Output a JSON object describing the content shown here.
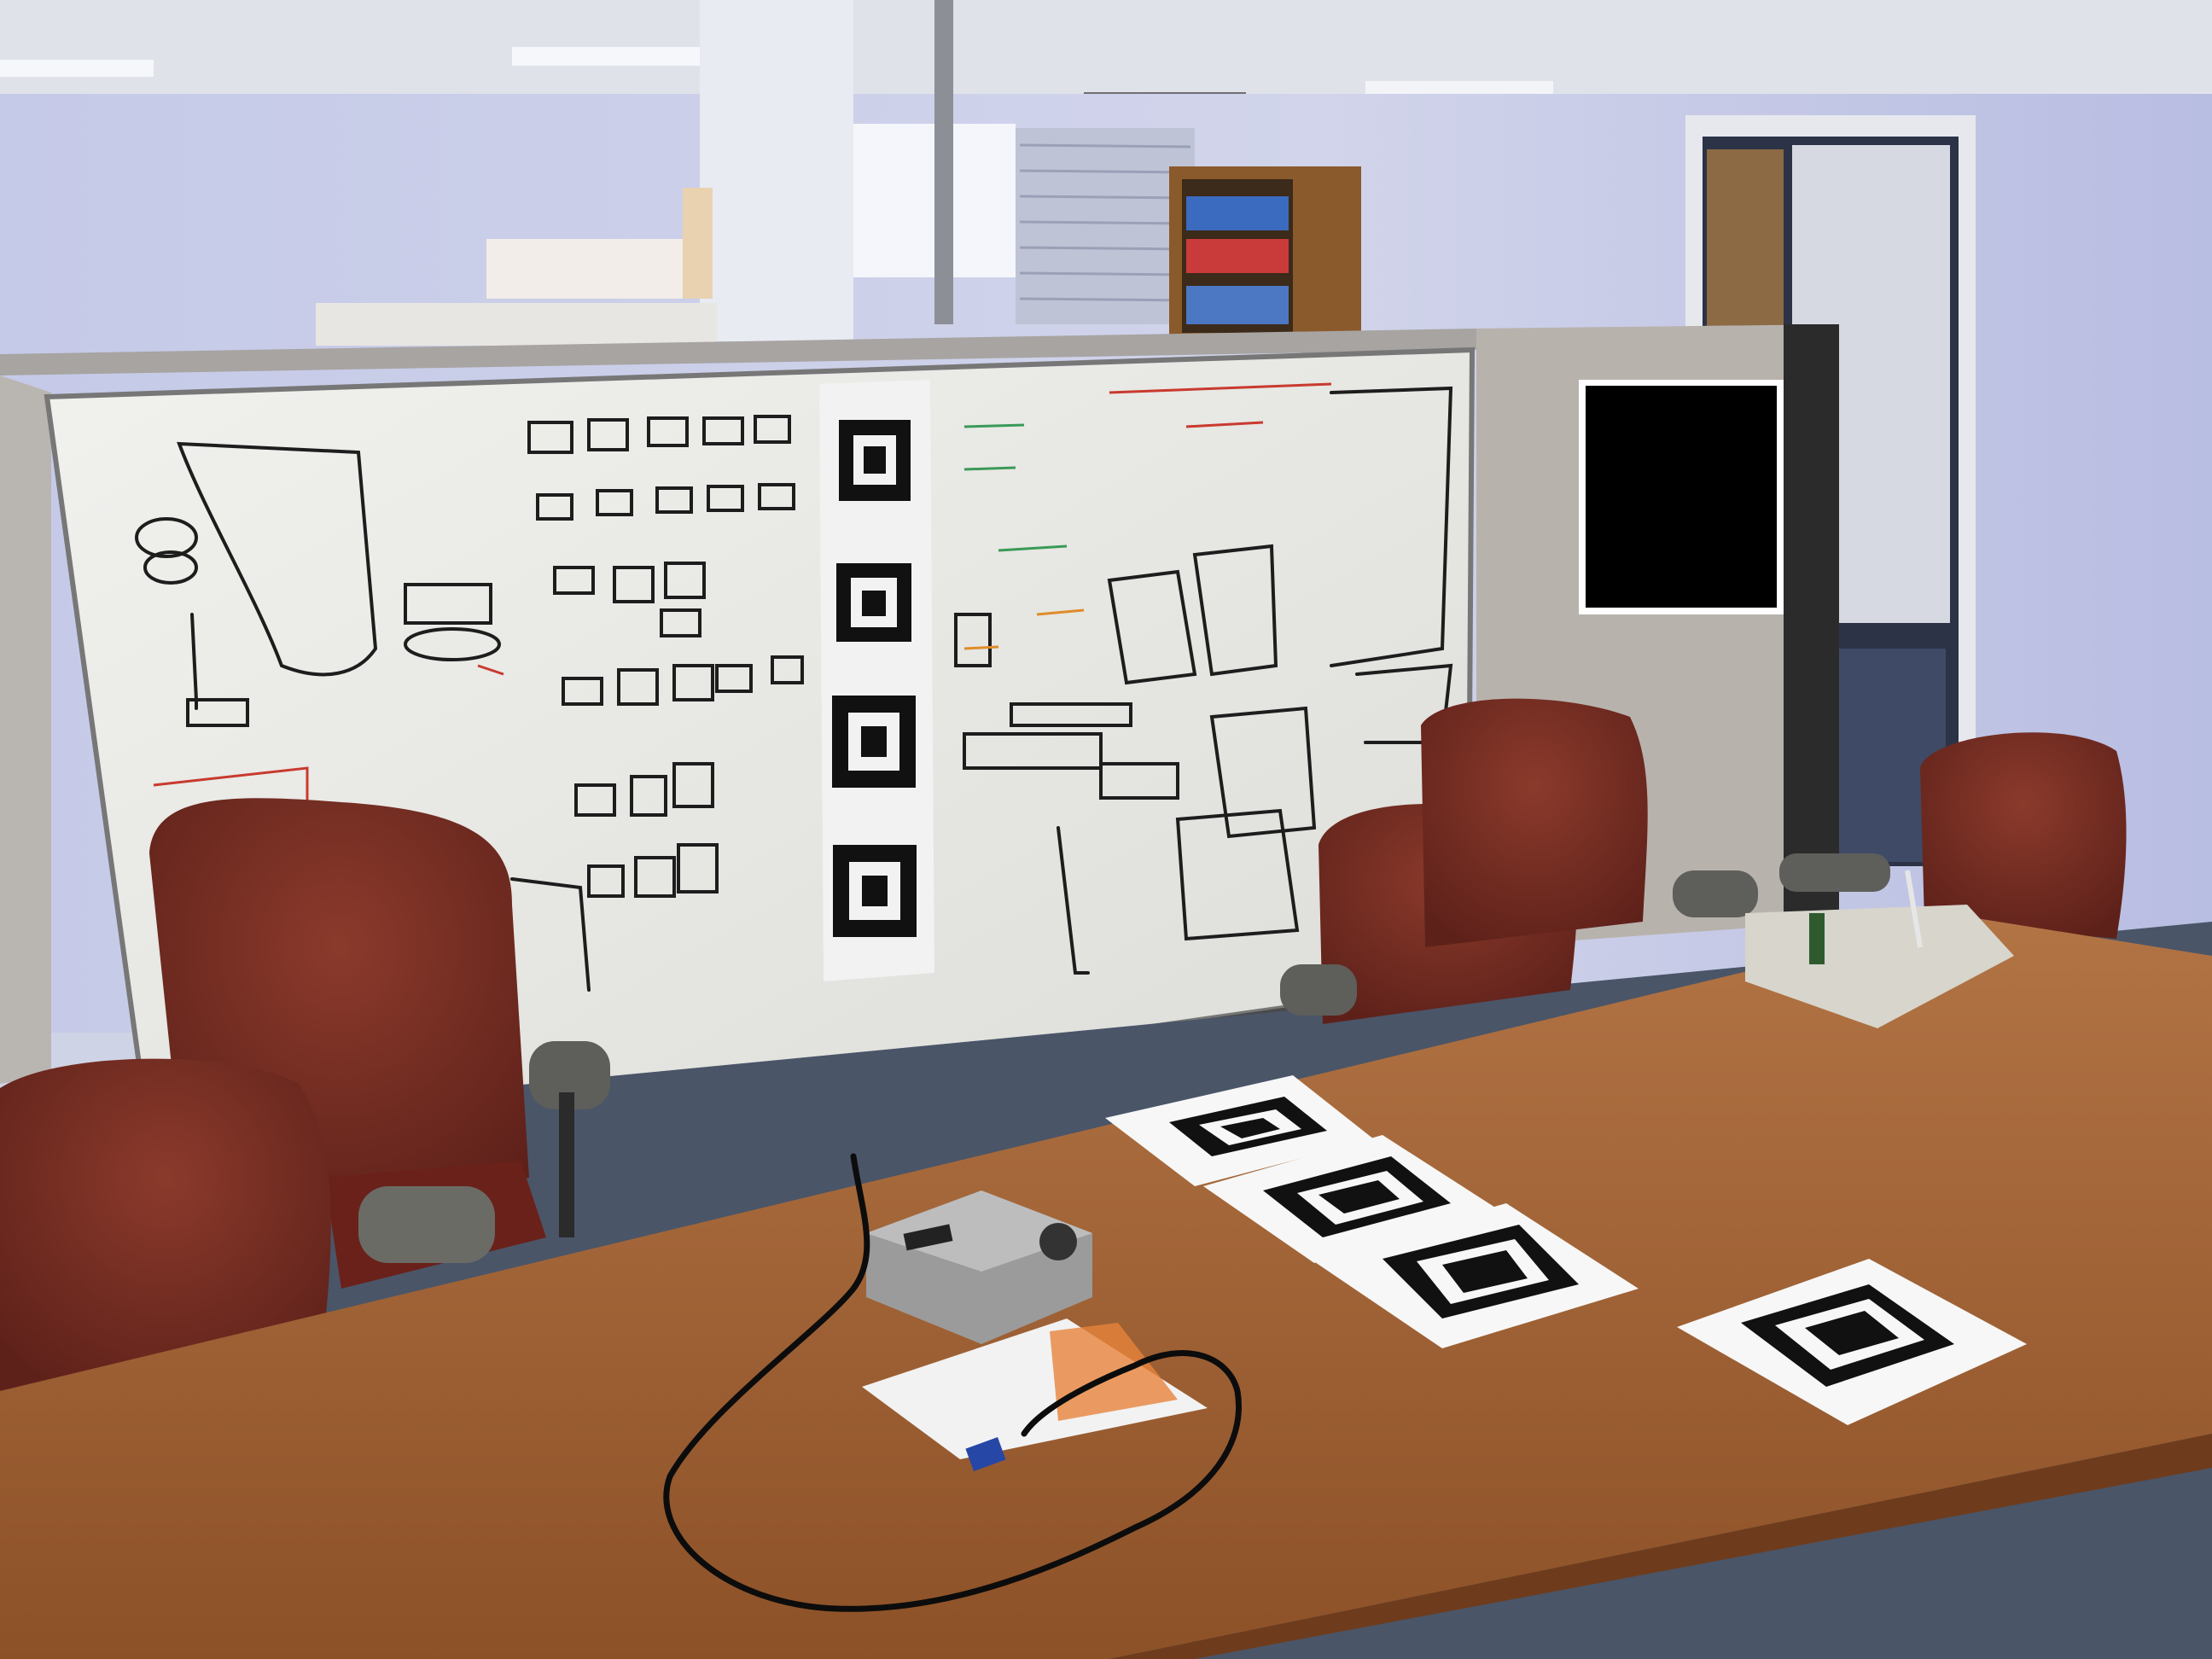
{
  "photo": {
    "scene": "",
    "colors": {
      "wall": "#c9cde6",
      "ceiling": "#dfe1ea",
      "whiteboard": "#eeeeea",
      "partition": "#b8b2ad",
      "table": "#a8683a",
      "table_dark": "#8a4f28",
      "chair": "#7a2e22",
      "chair_shadow": "#4e1a14",
      "marker_black": "#111111",
      "paper": "#f7f7f7",
      "projector": "#9b9b9b",
      "cable": "#0c0c0c",
      "floor": "#4a5568"
    },
    "objects": [
      "whiteboard",
      "fiducial-marker",
      "conference-table",
      "office-chair",
      "projector",
      "cable",
      "bookshelf",
      "door",
      "window",
      "ceiling-tiles",
      "redacted-region"
    ]
  }
}
